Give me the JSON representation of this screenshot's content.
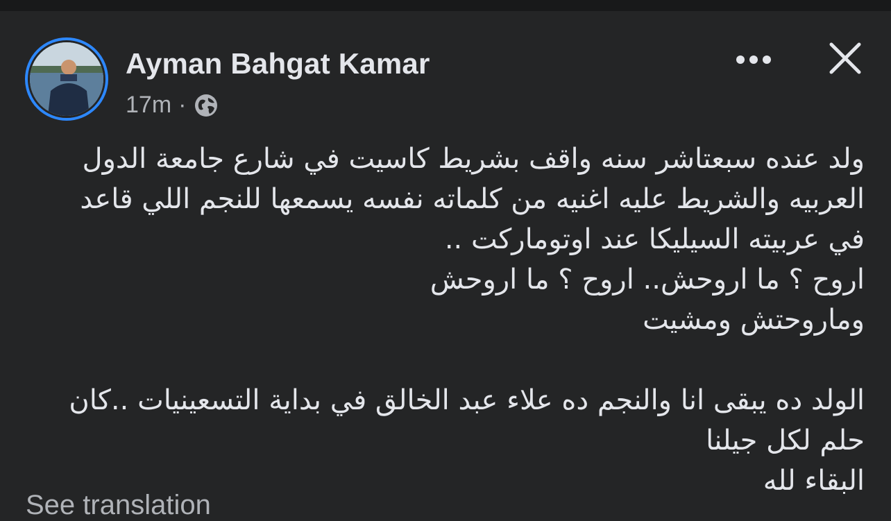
{
  "post": {
    "author": "Ayman Bahgat Kamar",
    "time": "17m",
    "separator": "·",
    "audience_icon": "globe-icon",
    "more_icon": "more-horizontal-icon",
    "close_icon": "close-icon",
    "body_lines": [
      "ولد عنده سبعتاشر سنه واقف بشريط كاسيت في شارع جامعة الدول",
      "العربيه والشريط عليه اغنيه من كلماته نفسه يسمعها للنجم  اللي قاعد",
      "في عربيته السيليكا عند اوتوماركت ..",
      "اروح ؟ ما اروحش.. اروح ؟ ما اروحش",
      "وماروحتش ومشيت",
      "",
      "الولد ده يبقى انا والنجم ده علاء عبد الخالق في بداية التسعينيات ..كان",
      "حلم لكل جيلنا",
      "البقاء لله"
    ],
    "see_translation": "See translation"
  },
  "colors": {
    "background": "#242526",
    "text_primary": "#e4e6eb",
    "text_secondary": "#b0b3b8",
    "avatar_ring": "#2d88ff"
  }
}
